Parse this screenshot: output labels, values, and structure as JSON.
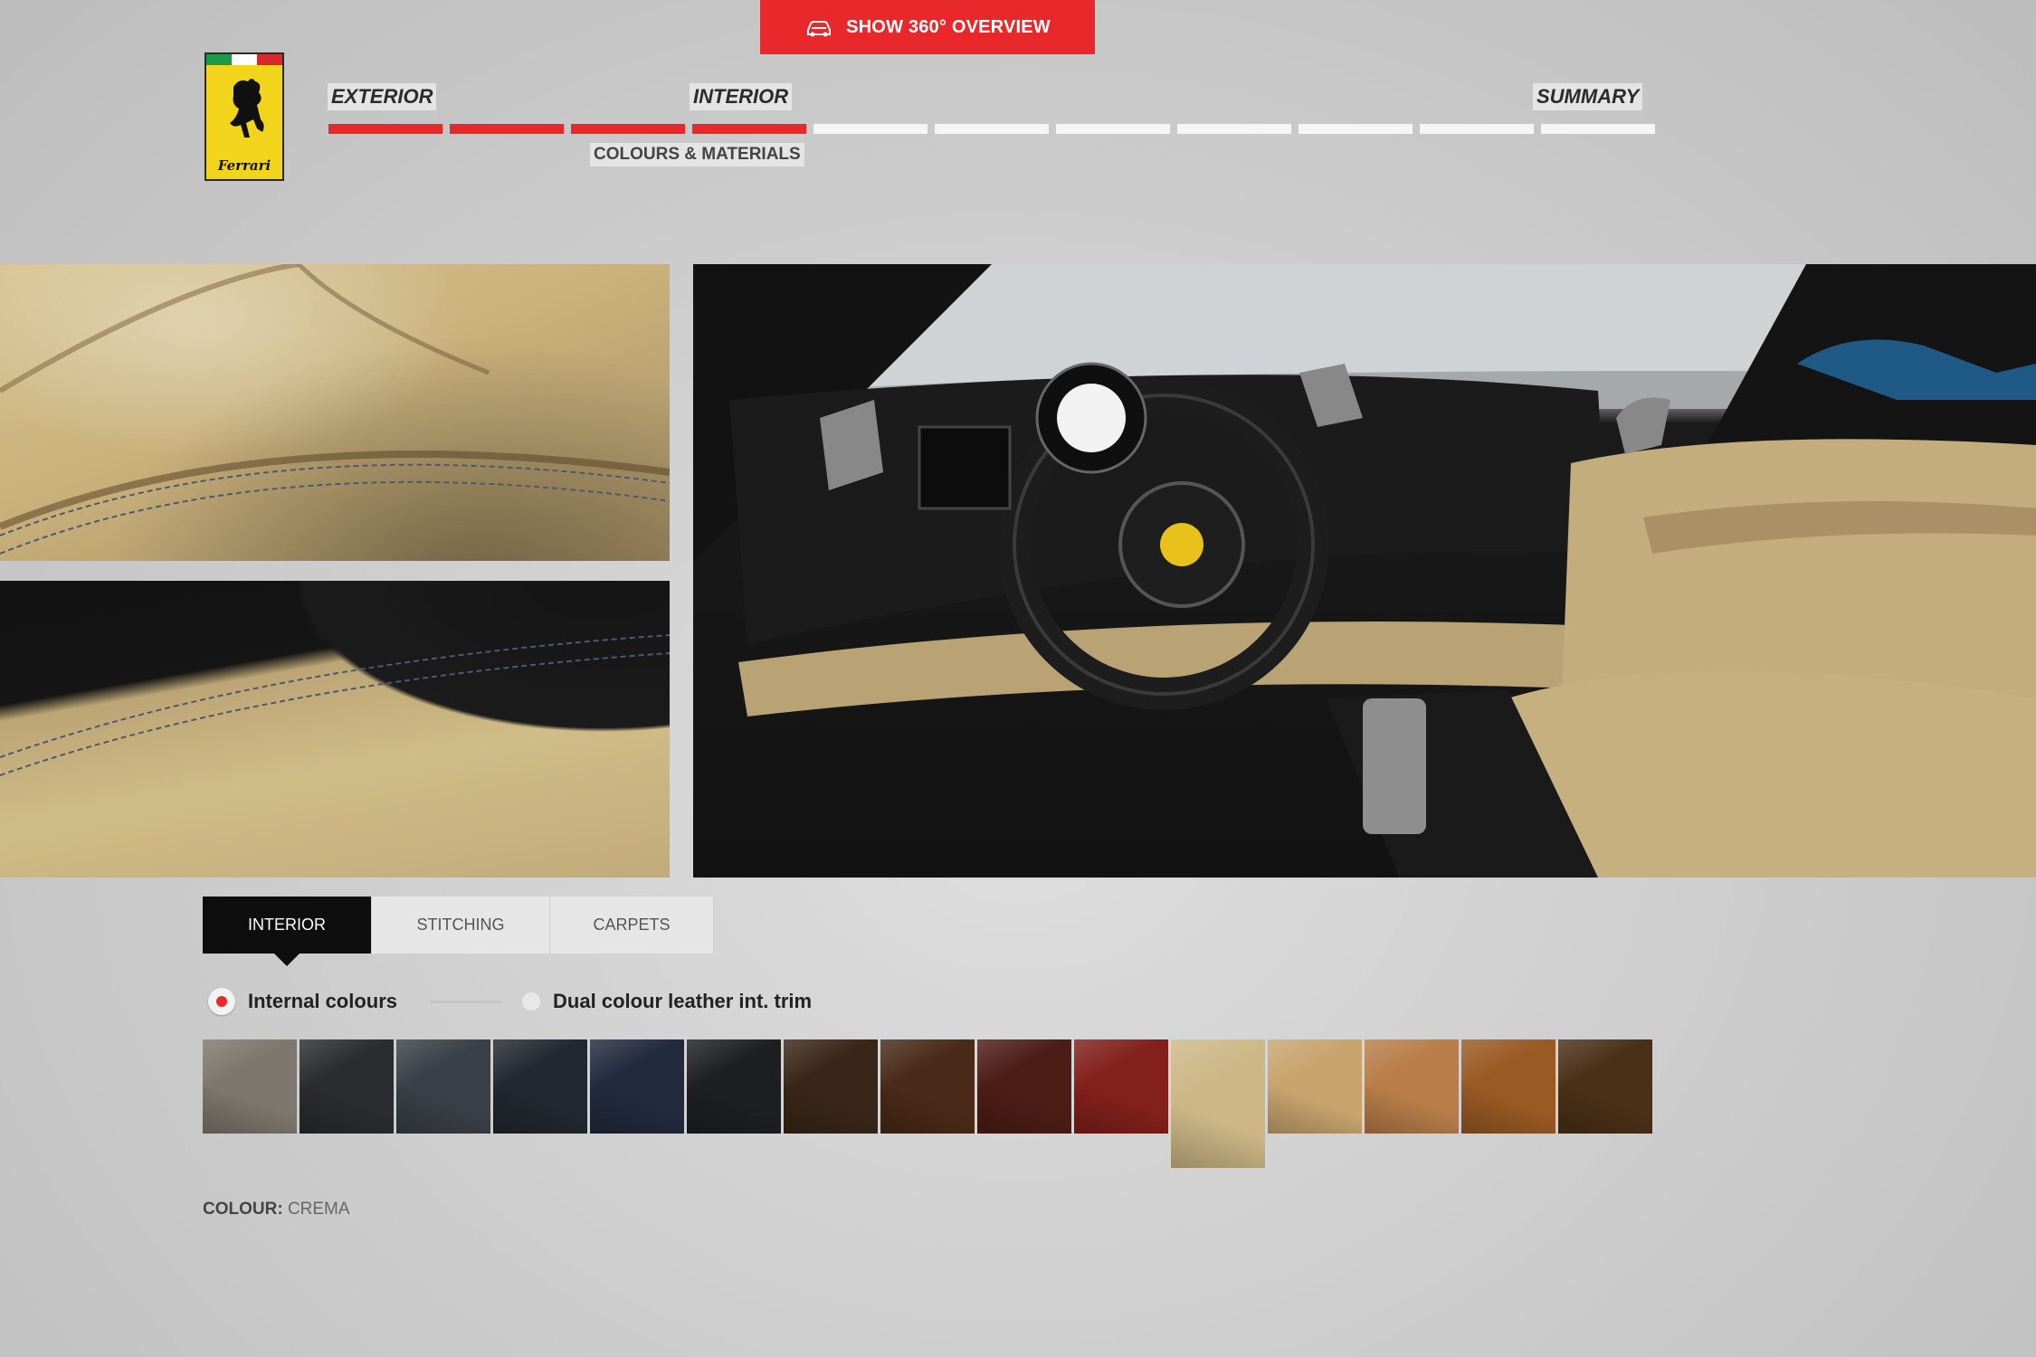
{
  "header": {
    "cta_label": "SHOW 360° OVERVIEW",
    "logo_text": "Ferrari"
  },
  "steps": {
    "exterior": "EXTERIOR",
    "interior": "INTERIOR",
    "summary": "SUMMARY",
    "sub_step": "COLOURS & MATERIALS",
    "total_segments": 11,
    "completed_segments": 4
  },
  "tabs": [
    {
      "label": "INTERIOR",
      "active": true
    },
    {
      "label": "STITCHING",
      "active": false
    },
    {
      "label": "CARPETS",
      "active": false
    }
  ],
  "options": {
    "internal_colours": "Internal colours",
    "dual_colour": "Dual colour leather int. trim"
  },
  "swatches": [
    {
      "color": "#7d776d",
      "selected": false
    },
    {
      "color": "#2b2c2f",
      "selected": false
    },
    {
      "color": "#3a4047",
      "selected": false
    },
    {
      "color": "#23272f",
      "selected": false
    },
    {
      "color": "#222a3d",
      "selected": false
    },
    {
      "color": "#1e1f20",
      "selected": false
    },
    {
      "color": "#3a2619",
      "selected": false
    },
    {
      "color": "#4a2a18",
      "selected": false
    },
    {
      "color": "#4c1d16",
      "selected": false
    },
    {
      "color": "#82201b",
      "selected": false
    },
    {
      "color": "#cdb786",
      "selected": true
    },
    {
      "color": "#c8a46e",
      "selected": false
    },
    {
      "color": "#b87d49",
      "selected": false
    },
    {
      "color": "#9a5a24",
      "selected": false
    },
    {
      "color": "#4b3018",
      "selected": false
    }
  ],
  "colour": {
    "label": "COLOUR:",
    "value": "CREMA"
  },
  "colors": {
    "accent": "#e8282b"
  }
}
